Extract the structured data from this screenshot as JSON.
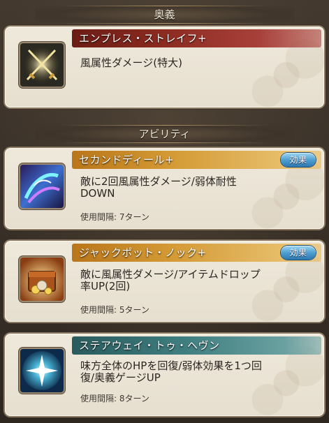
{
  "sections": {
    "ougi": "奥義",
    "ability": "アビリティ"
  },
  "ougi": {
    "name": "エンプレス・ストレイフ+",
    "description": "風属性ダメージ(特大)",
    "icon": "crossed-swords-icon"
  },
  "abilities": [
    {
      "name": "セカンドディール+",
      "effect_button": "効果",
      "description": "敵に2回風属性ダメージ/弱体耐性\nDOWN",
      "cooldown": "使用間隔: 7ターン",
      "bar_color": "#b9761a",
      "icon": "swirl-magic-icon"
    },
    {
      "name": "ジャックポット・ノック+",
      "effect_button": "効果",
      "description": "敵に風属性ダメージ/アイテムドロップ\n率UP(2回)",
      "cooldown": "使用間隔: 5ターン",
      "bar_color": "#b9761a",
      "icon": "treasure-chest-icon"
    },
    {
      "name": "ステアウェイ・トゥ・ヘヴン",
      "description": "味方全体のHPを回復/弱体効果を1つ回\n復/奥義ゲージUP",
      "cooldown": "使用間隔: 8ターン",
      "bar_color": "#2a5b5d",
      "icon": "sparkle-star-icon"
    }
  ]
}
